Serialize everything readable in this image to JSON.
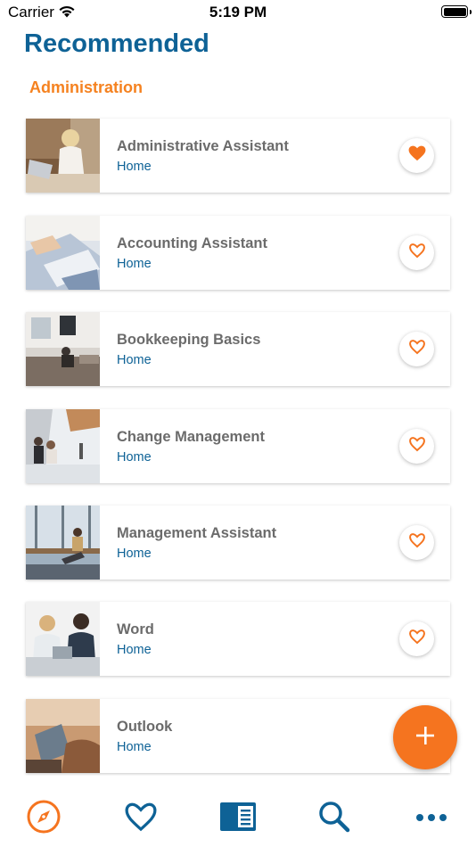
{
  "status_bar": {
    "carrier": "Carrier",
    "time": "5:19 PM"
  },
  "page_title": "Recommended",
  "section_title": "Administration",
  "courses": [
    {
      "title": "Administrative Assistant",
      "subtitle": "Home",
      "favorited": true
    },
    {
      "title": "Accounting Assistant",
      "subtitle": "Home",
      "favorited": false
    },
    {
      "title": "Bookkeeping Basics",
      "subtitle": "Home",
      "favorited": false
    },
    {
      "title": "Change Management",
      "subtitle": "Home",
      "favorited": false
    },
    {
      "title": "Management Assistant",
      "subtitle": "Home",
      "favorited": false
    },
    {
      "title": "Word",
      "subtitle": "Home",
      "favorited": false
    },
    {
      "title": "Outlook",
      "subtitle": "Home",
      "favorited": false
    }
  ],
  "fab_icon": "plus-icon",
  "tabs": [
    {
      "icon": "compass-icon",
      "active": true
    },
    {
      "icon": "heart-icon",
      "active": false
    },
    {
      "icon": "catalog-icon",
      "active": false
    },
    {
      "icon": "search-icon",
      "active": false
    },
    {
      "icon": "more-icon",
      "active": false
    }
  ],
  "colors": {
    "brand_blue": "#0e6296",
    "accent_orange": "#f58220",
    "fab_orange": "#f5741f"
  }
}
